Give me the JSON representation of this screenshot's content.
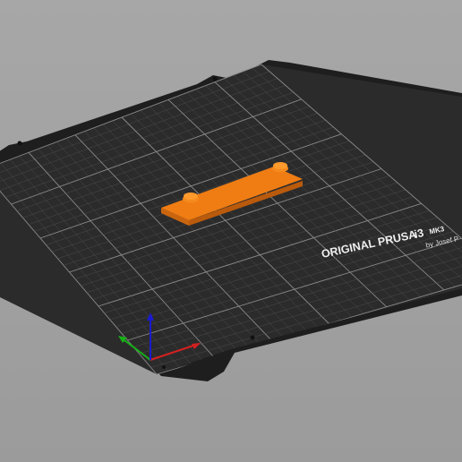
{
  "viewport": {
    "background": "#a2a2a2"
  },
  "bed": {
    "brand_line": "ORIGINAL PRUSA",
    "model_i3": "i3",
    "model_mk3": "MK3",
    "author": "by Josef P",
    "surface_color": "#2b2b2b",
    "grid_color": "#4c4c4c",
    "major_grid_color": "#8a8a8a"
  },
  "part": {
    "color": "#e07211",
    "top_color": "#ef7d14",
    "side_color": "#b95a0c"
  },
  "axes": {
    "x_color": "#d42020",
    "y_color": "#18b018",
    "z_color": "#1a1ad0"
  }
}
